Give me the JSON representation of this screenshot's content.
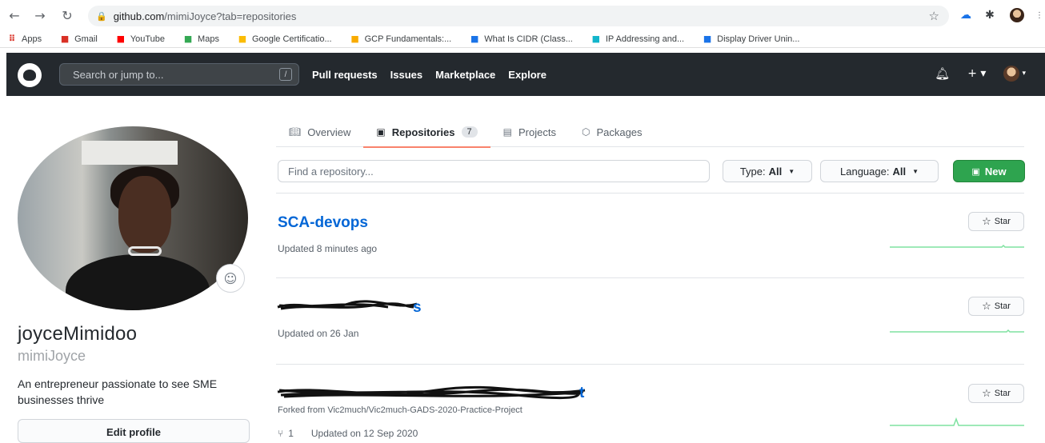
{
  "browser": {
    "url_host": "github.com",
    "url_path": "/mimiJoyce?tab=repositories",
    "bookmarks": [
      {
        "label": "Apps",
        "color": "#d93025"
      },
      {
        "label": "Gmail",
        "color": "#d93025"
      },
      {
        "label": "YouTube",
        "color": "#ff0000"
      },
      {
        "label": "Maps",
        "color": "#34a853"
      },
      {
        "label": "Google Certificatio...",
        "color": "#fbbc04"
      },
      {
        "label": "GCP Fundamentals:...",
        "color": "#f9ab00"
      },
      {
        "label": "What Is CIDR (Class...",
        "color": "#1a73e8"
      },
      {
        "label": "IP Addressing and...",
        "color": "#12b5cb"
      },
      {
        "label": "Display Driver Unin...",
        "color": "#1a73e8"
      }
    ]
  },
  "header": {
    "search_placeholder": "Search or jump to...",
    "search_key": "/",
    "nav": [
      "Pull requests",
      "Issues",
      "Marketplace",
      "Explore"
    ],
    "plus": "+ ▾",
    "avatar_caret": "▾"
  },
  "profile": {
    "name": "joyceMimidoo",
    "login": "mimiJoyce",
    "bio": "An entrepreneur passionate to see SME businesses thrive",
    "edit_label": "Edit profile"
  },
  "tabs": [
    {
      "label": "Overview",
      "icon": "book-icon"
    },
    {
      "label": "Repositories",
      "icon": "repo-icon",
      "count": "7",
      "active": true
    },
    {
      "label": "Projects",
      "icon": "project-icon"
    },
    {
      "label": "Packages",
      "icon": "package-icon"
    }
  ],
  "filters": {
    "find_placeholder": "Find a repository...",
    "type_label": "Type:",
    "type_value": "All",
    "language_label": "Language:",
    "language_value": "All",
    "new_label": "New"
  },
  "repos": [
    {
      "title": "SCA-devops",
      "updated": "Updated 8 minutes ago",
      "star": "Star"
    },
    {
      "title_fragment": "s",
      "updated": "Updated on 26 Jan",
      "star": "Star"
    },
    {
      "title_fragment": "t",
      "forked_from": "Forked from Vic2much/Vic2much-GADS-2020-Practice-Project",
      "forks": "1",
      "updated": "Updated on 12 Sep 2020",
      "star": "Star"
    }
  ],
  "colors": {
    "header_bg": "#24292e",
    "link": "#0366d6",
    "new_button": "#2ea44f",
    "tab_underline": "#f9826c",
    "sparkline": "#7ee2a0"
  }
}
